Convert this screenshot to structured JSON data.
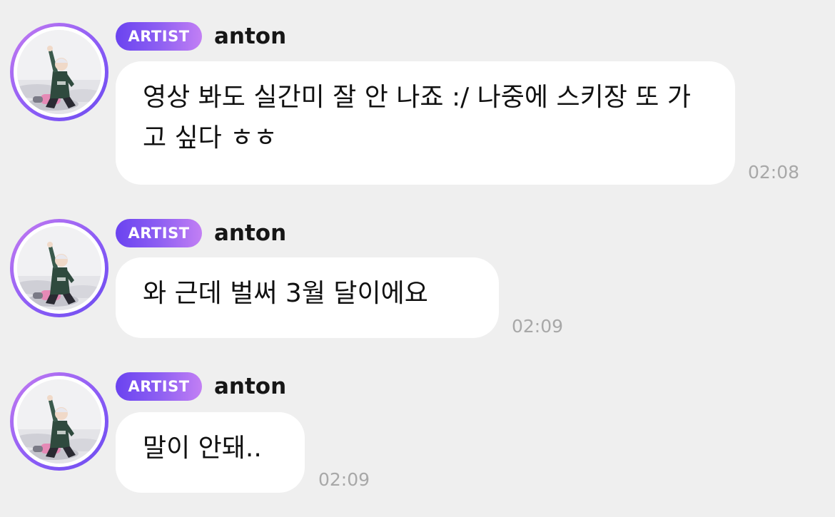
{
  "colors": {
    "background": "#efefef",
    "bubble": "#ffffff",
    "badge_gradient_start": "#6a43f0",
    "badge_gradient_end": "#c27ff4",
    "avatar_ring": "#8b5cf6",
    "timestamp": "#a8a8a8"
  },
  "messages": [
    {
      "badge": "ARTIST",
      "sender": "anton",
      "text": "영상 봐도 실간미 잘 안 나죠 :/ 나중에 스키장 또 가고 싶다 ㅎㅎ",
      "time": "02:08"
    },
    {
      "badge": "ARTIST",
      "sender": "anton",
      "text": "와 근데 벌써 3월 달이에요",
      "time": "02:09"
    },
    {
      "badge": "ARTIST",
      "sender": "anton",
      "text": "말이 안돼..",
      "time": "02:09"
    }
  ]
}
